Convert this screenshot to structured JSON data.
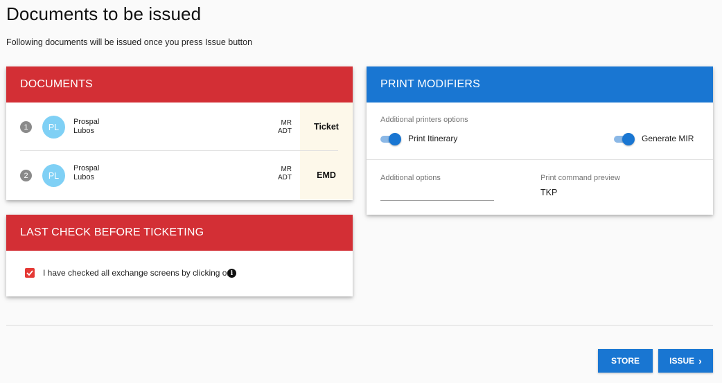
{
  "page": {
    "title": "Documents to be issued",
    "subtitle": "Following documents will be issued once you press Issue button"
  },
  "documents": {
    "header": "DOCUMENTS",
    "rows": [
      {
        "number": "1",
        "initials": "PL",
        "last_name": "Prospal",
        "first_name": "Lubos",
        "title": "MR",
        "pax_type": "ADT",
        "doc_type": "Ticket"
      },
      {
        "number": "2",
        "initials": "PL",
        "last_name": "Prospal",
        "first_name": "Lubos",
        "title": "MR",
        "pax_type": "ADT",
        "doc_type": "EMD"
      }
    ]
  },
  "last_check": {
    "header": "LAST CHECK BEFORE TICKETING",
    "checkbox_label": "I have checked all exchange screens by clicking on",
    "checked": true,
    "info_glyph": "i"
  },
  "print_modifiers": {
    "header": "PRINT MODIFIERS",
    "printers_label": "Additional printers options",
    "toggle_itinerary_label": "Print Itinerary",
    "toggle_itinerary_on": true,
    "toggle_mir_label": "Generate MIR",
    "toggle_mir_on": true,
    "additional_options_label": "Additional options",
    "additional_options_value": "",
    "preview_label": "Print command preview",
    "preview_value": "TKP"
  },
  "actions": {
    "store_label": "STORE",
    "issue_label": "ISSUE"
  },
  "colors": {
    "red_header": "#d32f35",
    "blue_header": "#1976d2",
    "avatar": "#7fd0f5",
    "doc_type_bg": "#fdf8ea"
  }
}
